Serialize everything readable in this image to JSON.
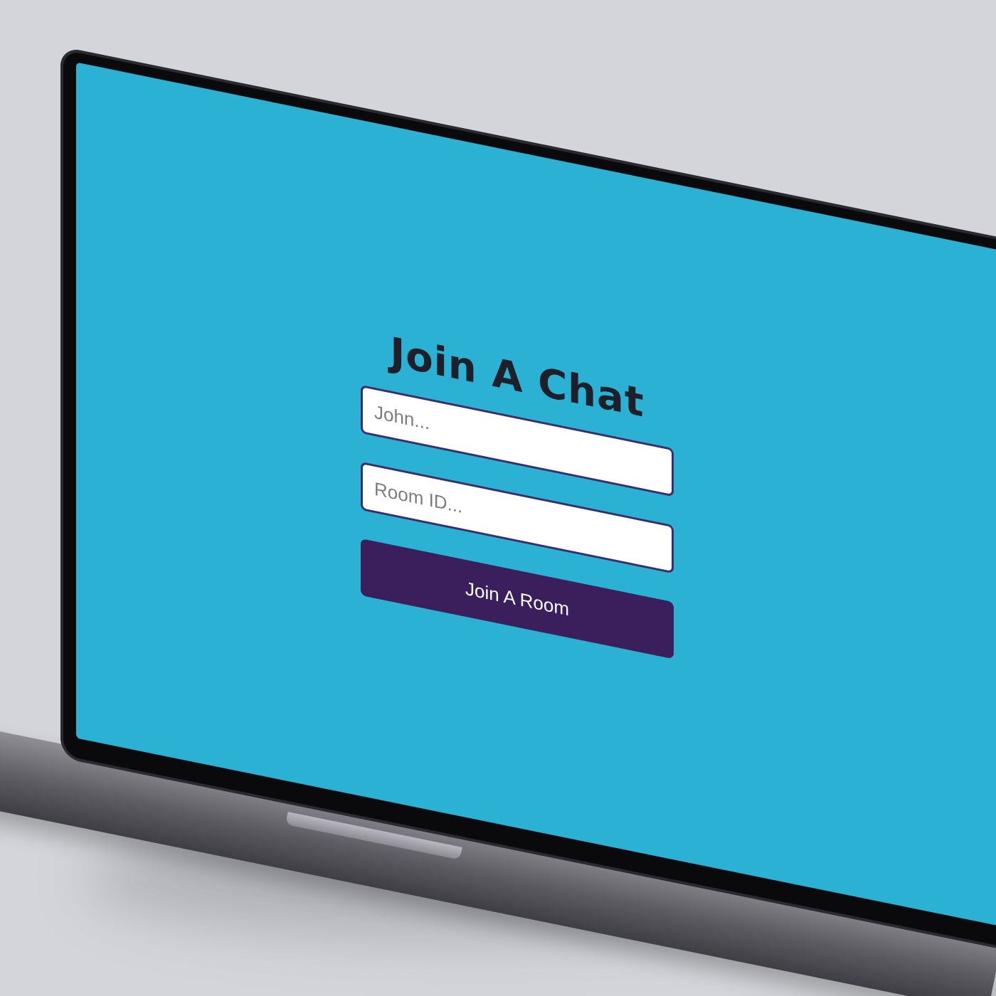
{
  "page": {
    "title": "Join A Chat"
  },
  "form": {
    "name_placeholder": "John...",
    "room_placeholder": "Room ID...",
    "submit_label": "Join A Room"
  },
  "colors": {
    "screen_background": "#2bb1d3",
    "button_background": "#3a1f5c",
    "field_border": "#3a2e6e",
    "title_color": "#1d1f2b"
  }
}
